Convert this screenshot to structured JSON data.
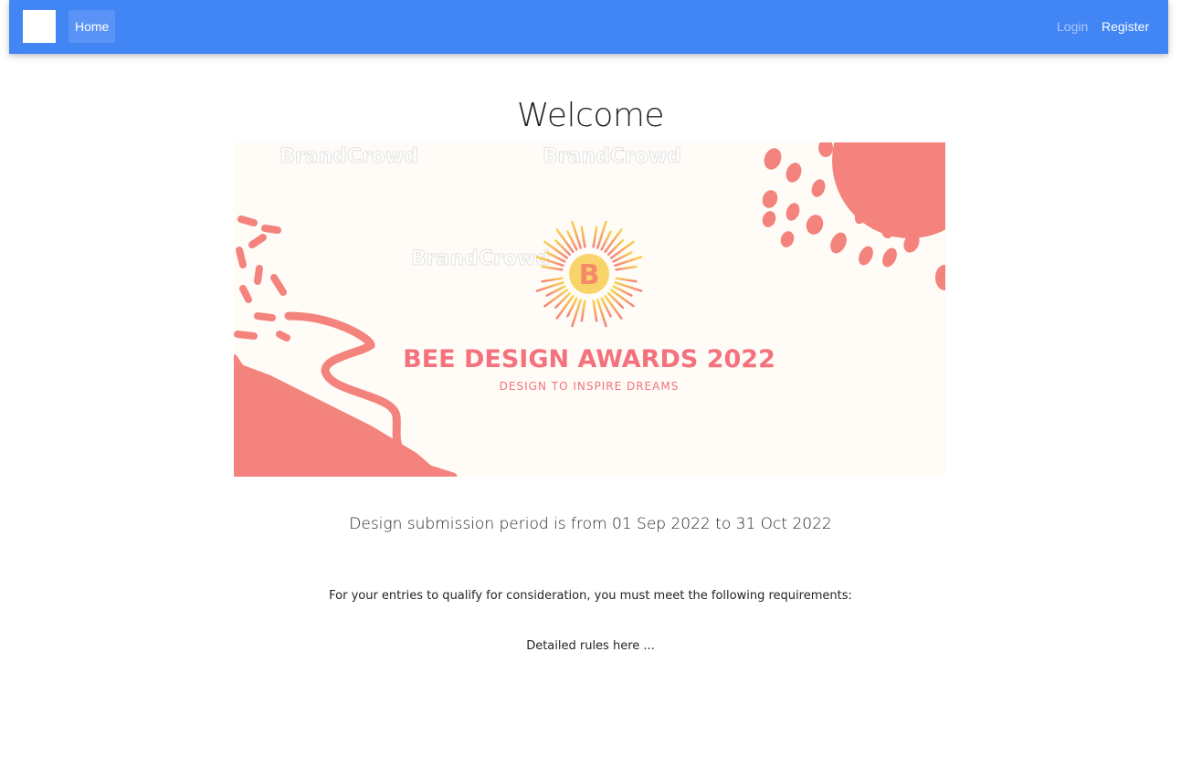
{
  "navbar": {
    "home_label": "Home",
    "login_label": "Login",
    "register_label": "Register",
    "brand_color": "#4285f4"
  },
  "main": {
    "title": "Welcome",
    "banner": {
      "watermark": "BrandCrowd",
      "logo_letter": "B",
      "heading": "BEE DESIGN AWARDS 2022",
      "tagline": "DESIGN TO INSPIRE DREAMS",
      "accent_color": "#f4827d",
      "gold_color": "#f7c14f"
    },
    "submission_period": "Design submission period is from 01 Sep 2022 to 31 Oct 2022",
    "requirements_intro": "For your entries to qualify for consideration, you must meet the following requirements:",
    "rules_text": "Detailed rules here ..."
  }
}
